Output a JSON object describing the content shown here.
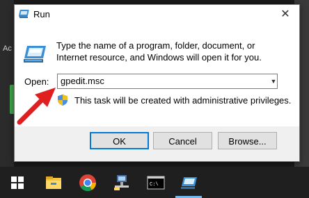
{
  "dialog": {
    "title": "Run",
    "close_glyph": "✕",
    "description": "Type the name of a program, folder, document, or Internet resource, and Windows will open it for you.",
    "open_label": "Open:",
    "open_value": "gpedit.msc",
    "admin_note": "This task will be created with administrative privileges.",
    "buttons": {
      "ok": "OK",
      "cancel": "Cancel",
      "browse": "Browse..."
    }
  },
  "background": {
    "edge_text": "Ac"
  },
  "taskbar": {
    "items": [
      "windows-start-icon",
      "file-explorer-icon",
      "chrome-icon",
      "network-icon",
      "command-prompt-icon",
      "run-icon"
    ]
  },
  "colors": {
    "accent": "#0078d7",
    "arrow": "#e02020",
    "taskbar": "#1f1f1f"
  }
}
